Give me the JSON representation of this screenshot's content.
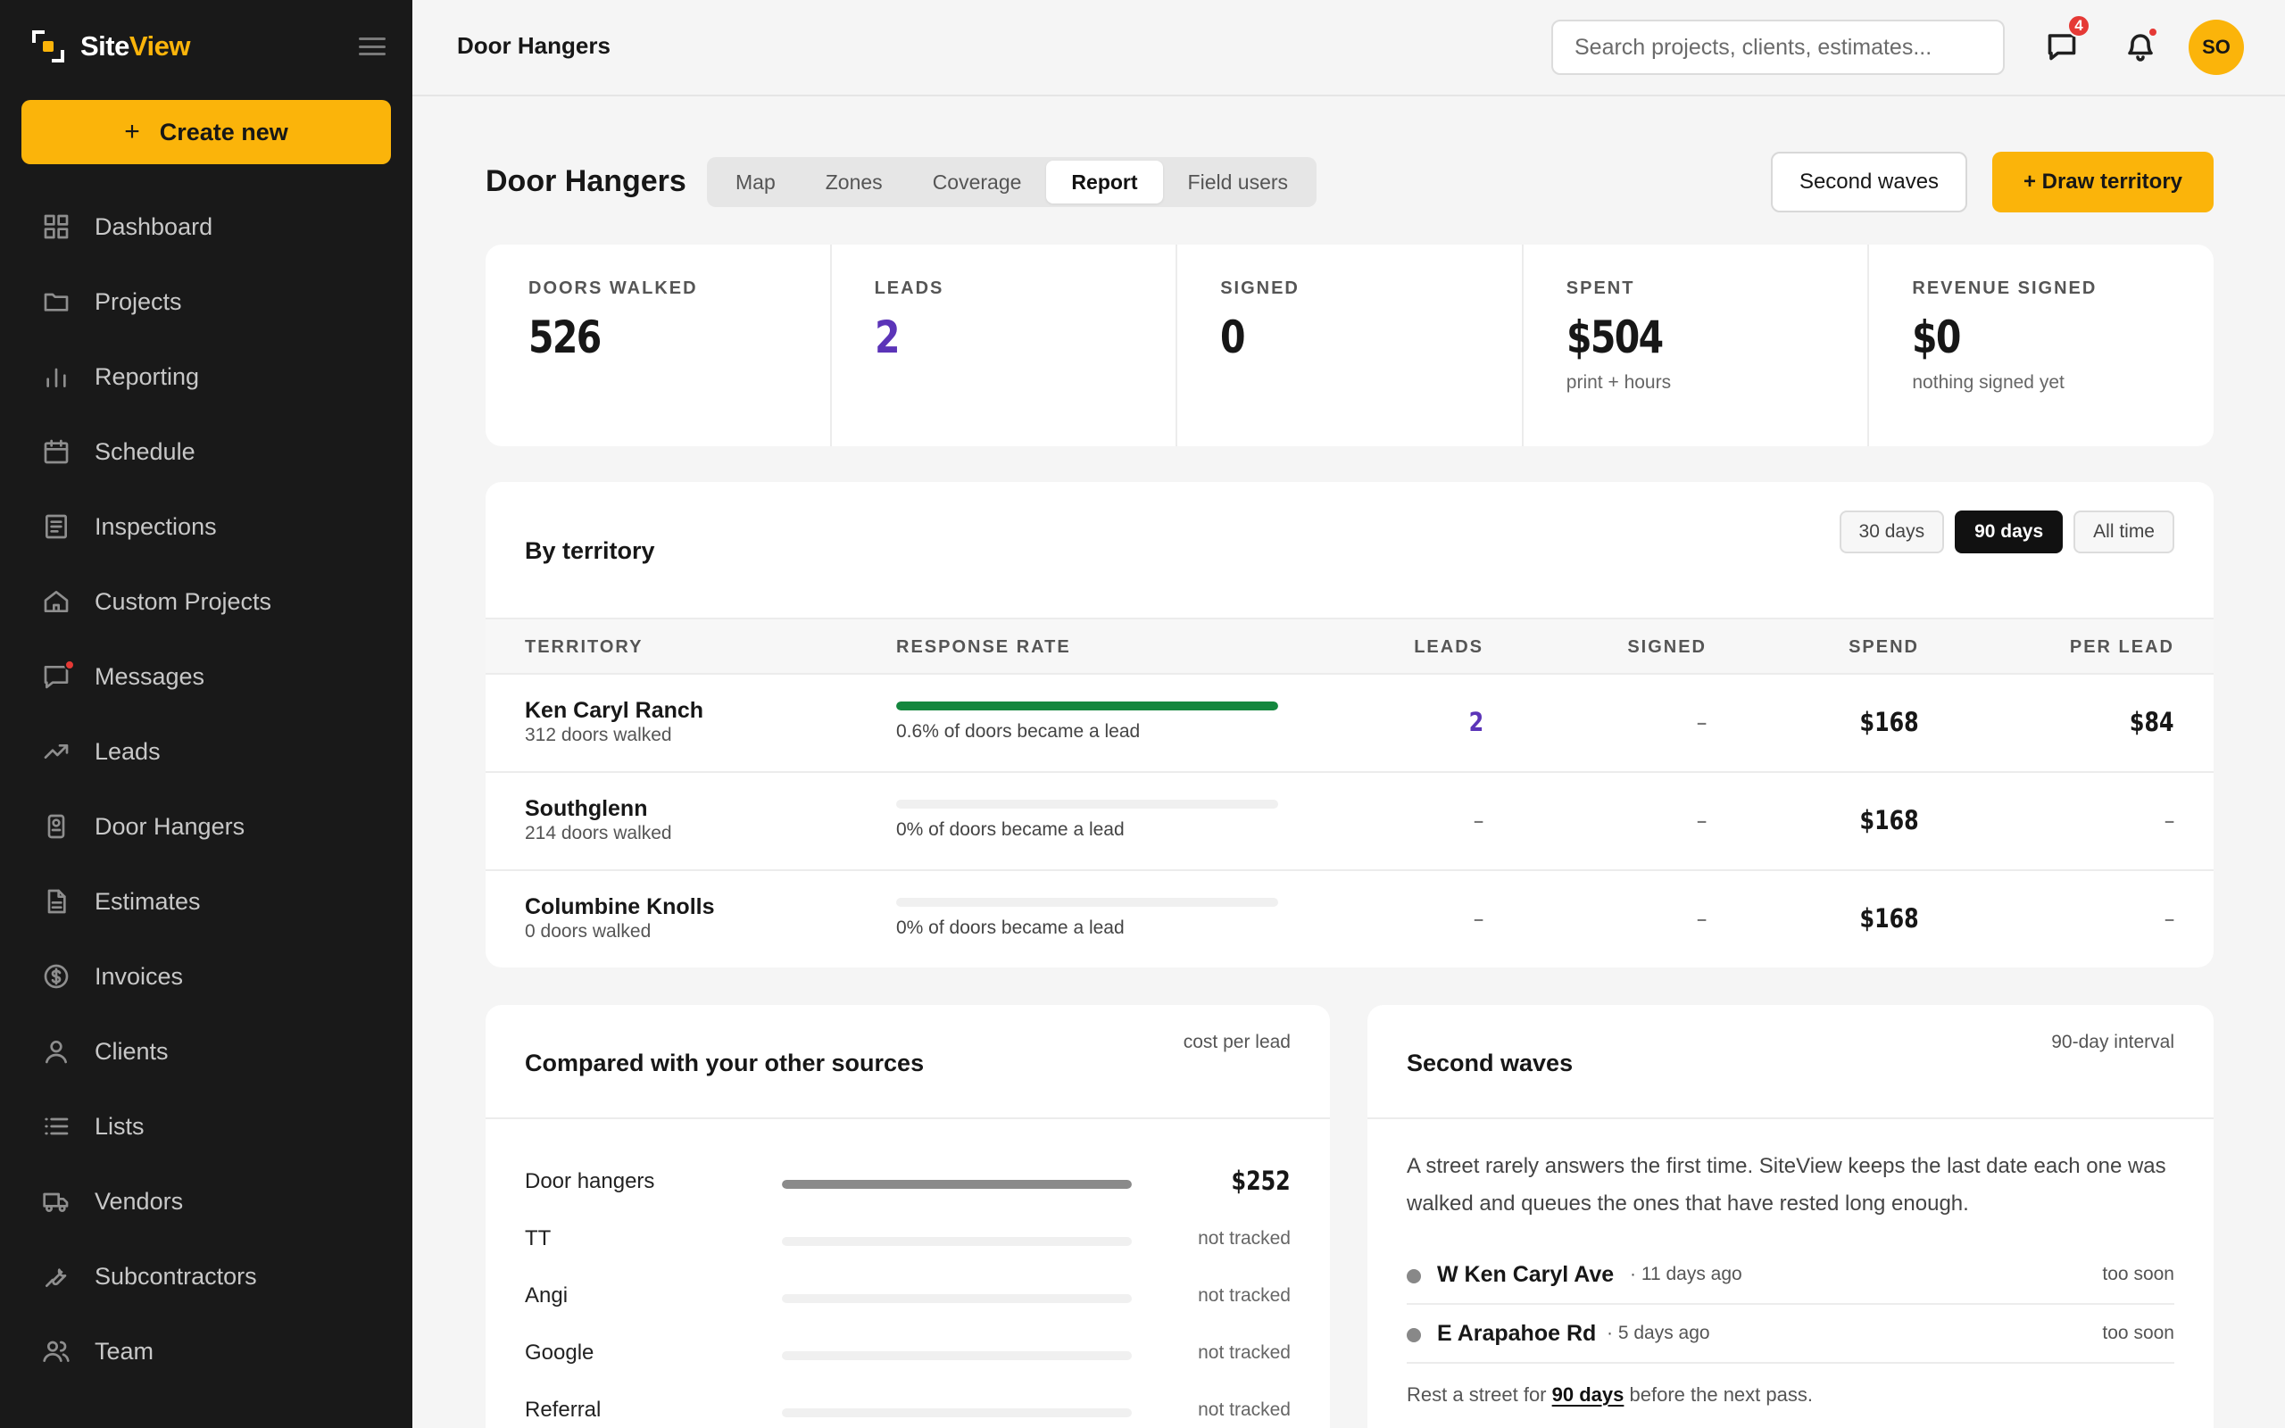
{
  "brand": {
    "name_a": "Site",
    "name_b": "View",
    "accent": "#fbb40a"
  },
  "sidebar": {
    "create_label": "Create new",
    "items": [
      {
        "label": "Dashboard",
        "icon": "grid-icon"
      },
      {
        "label": "Projects",
        "icon": "folder-icon"
      },
      {
        "label": "Reporting",
        "icon": "bar-chart-icon"
      },
      {
        "label": "Schedule",
        "icon": "calendar-icon"
      },
      {
        "label": "Inspections",
        "icon": "clipboard-icon"
      },
      {
        "label": "Custom Projects",
        "icon": "home-icon"
      },
      {
        "label": "Messages",
        "icon": "message-icon"
      },
      {
        "label": "Leads",
        "icon": "trending-up-icon"
      },
      {
        "label": "Door Hangers",
        "icon": "door-hanger-icon"
      },
      {
        "label": "Estimates",
        "icon": "file-icon"
      },
      {
        "label": "Invoices",
        "icon": "dollar-icon"
      },
      {
        "label": "Clients",
        "icon": "user-icon"
      },
      {
        "label": "Lists",
        "icon": "list-icon"
      },
      {
        "label": "Vendors",
        "icon": "truck-icon"
      },
      {
        "label": "Subcontractors",
        "icon": "wrench-icon"
      },
      {
        "label": "Team",
        "icon": "users-icon"
      }
    ]
  },
  "topbar": {
    "page_name": "Door Hangers",
    "search_placeholder": "Search projects, clients, estimates...",
    "messages_count": "4",
    "avatar_initials": "SO"
  },
  "main": {
    "title": "Door Hangers",
    "tabs": [
      {
        "label": "Map"
      },
      {
        "label": "Zones"
      },
      {
        "label": "Coverage"
      },
      {
        "label": "Report"
      },
      {
        "label": "Field users"
      }
    ],
    "active_tab": "Report",
    "second_waves_label": "Second waves",
    "draw_label": "+ Draw territory"
  },
  "stats": [
    {
      "key": "DOORS WALKED",
      "value": "526",
      "sub": ""
    },
    {
      "key": "LEADS",
      "value": "2",
      "sub": ""
    },
    {
      "key": "SIGNED",
      "value": "0",
      "sub": ""
    },
    {
      "key": "SPENT",
      "value": "$504",
      "sub": "print + hours"
    },
    {
      "key": "REVENUE SIGNED",
      "value": "$0",
      "sub": "nothing signed yet"
    }
  ],
  "territory": {
    "title": "By territory",
    "ranges": [
      "30 days",
      "90 days",
      "All time"
    ],
    "active_range": "90 days",
    "columns": [
      "TERRITORY",
      "RESPONSE RATE",
      "LEADS",
      "SIGNED",
      "SPEND",
      "PER LEAD"
    ],
    "rows": [
      {
        "name": "Ken Caryl Ranch",
        "doors": "312 doors walked",
        "rate_fraction": 1.0,
        "rate_label": "0.6% of doors became a lead",
        "leads": "2",
        "signed": "–",
        "spend": "$168",
        "per_lead": "$84"
      },
      {
        "name": "Southglenn",
        "doors": "214 doors walked",
        "rate_fraction": 0,
        "rate_label": "0% of doors became a lead",
        "leads": "–",
        "signed": "–",
        "spend": "$168",
        "per_lead": "–"
      },
      {
        "name": "Columbine Knolls",
        "doors": "0 doors walked",
        "rate_fraction": 0,
        "rate_label": "0% of doors became a lead",
        "leads": "–",
        "signed": "–",
        "spend": "$168",
        "per_lead": "–"
      }
    ]
  },
  "compare": {
    "title": "Compared with your other sources",
    "hint": "cost per lead",
    "rows": [
      {
        "name": "Door hangers",
        "fraction": 1.0,
        "value": "$252",
        "tracked": true
      },
      {
        "name": "TT",
        "fraction": 0,
        "value": "not tracked",
        "tracked": false
      },
      {
        "name": "Angi",
        "fraction": 0,
        "value": "not tracked",
        "tracked": false
      },
      {
        "name": "Google",
        "fraction": 0,
        "value": "not tracked",
        "tracked": false
      },
      {
        "name": "Referral",
        "fraction": 0,
        "value": "not tracked",
        "tracked": false
      }
    ]
  },
  "waves": {
    "title": "Second waves",
    "hint": "90-day interval",
    "description": "A street rarely answers the first time. SiteView keeps the last date each one was walked and queues the ones that have rested long enough.",
    "streets": [
      {
        "name": "W Ken Caryl Ave",
        "ago": "· 11 days ago",
        "state": "too soon"
      },
      {
        "name": "E Arapahoe Rd",
        "ago": "· 5 days ago",
        "state": "too soon"
      }
    ],
    "footer_a": "Rest a street for",
    "footer_b": "90 days",
    "footer_c": "before the next pass."
  }
}
